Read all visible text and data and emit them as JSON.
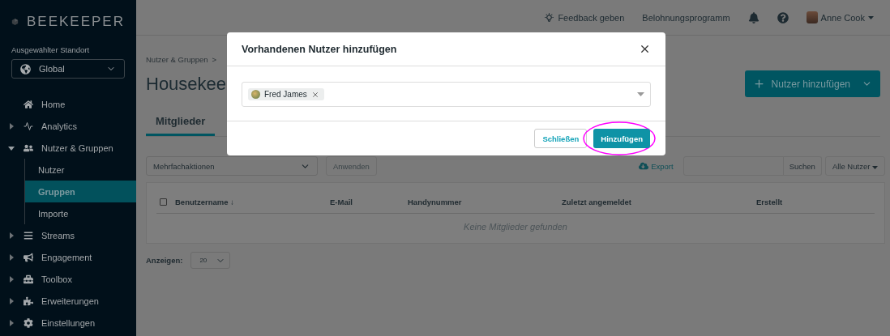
{
  "brand": {
    "name": "BEEKEEPER"
  },
  "location": {
    "label": "Ausgewählter Standort",
    "value": "Global"
  },
  "sidebar": {
    "items": [
      {
        "label": "Home",
        "selected": false
      },
      {
        "label": "Analytics",
        "expanded": false,
        "selected": false
      },
      {
        "label": "Nutzer & Gruppen",
        "expanded": true,
        "selected": false,
        "children": [
          {
            "label": "Nutzer",
            "selected": false
          },
          {
            "label": "Gruppen",
            "selected": true
          },
          {
            "label": "Importe",
            "selected": false
          }
        ]
      },
      {
        "label": "Streams",
        "expanded": false,
        "selected": false
      },
      {
        "label": "Engagement",
        "expanded": false,
        "selected": false
      },
      {
        "label": "Toolbox",
        "expanded": false,
        "selected": false
      },
      {
        "label": "Erweiterungen",
        "expanded": false,
        "selected": false
      },
      {
        "label": "Einstellungen",
        "expanded": false,
        "selected": false
      }
    ]
  },
  "topbar": {
    "feedback": "Feedback geben",
    "rewards": "Belohnungsprogramm",
    "user": "Anne Cook"
  },
  "breadcrumb": {
    "items": [
      "Nutzer & Gruppen"
    ],
    "separator": ">"
  },
  "heading": "Housekee",
  "add_button": "Nutzer hinzufügen",
  "tabs": [
    {
      "label": "Mitglieder",
      "selected": true
    }
  ],
  "toolbar": {
    "bulk_actions": "Mehrfachaktionen",
    "apply": "Anwenden",
    "export": "Export",
    "search_button": "Suchen",
    "filter": "Alle Nutzer"
  },
  "table": {
    "checked": false,
    "columns": [
      "Benutzername ↓",
      "E-Mail",
      "Handynummer",
      "Zuletzt angemeldet",
      "Erstellt"
    ],
    "empty_message": "Keine Mitglieder gefunden"
  },
  "page_size": {
    "label": "Anzeigen:",
    "value": "20"
  },
  "modal": {
    "title": "Vorhandenen Nutzer hinzufügen",
    "chips": [
      {
        "label": "Fred James"
      }
    ],
    "buttons": {
      "close": "Schließen",
      "confirm": "Hinzufügen"
    },
    "confirm_highlighted": true
  }
}
